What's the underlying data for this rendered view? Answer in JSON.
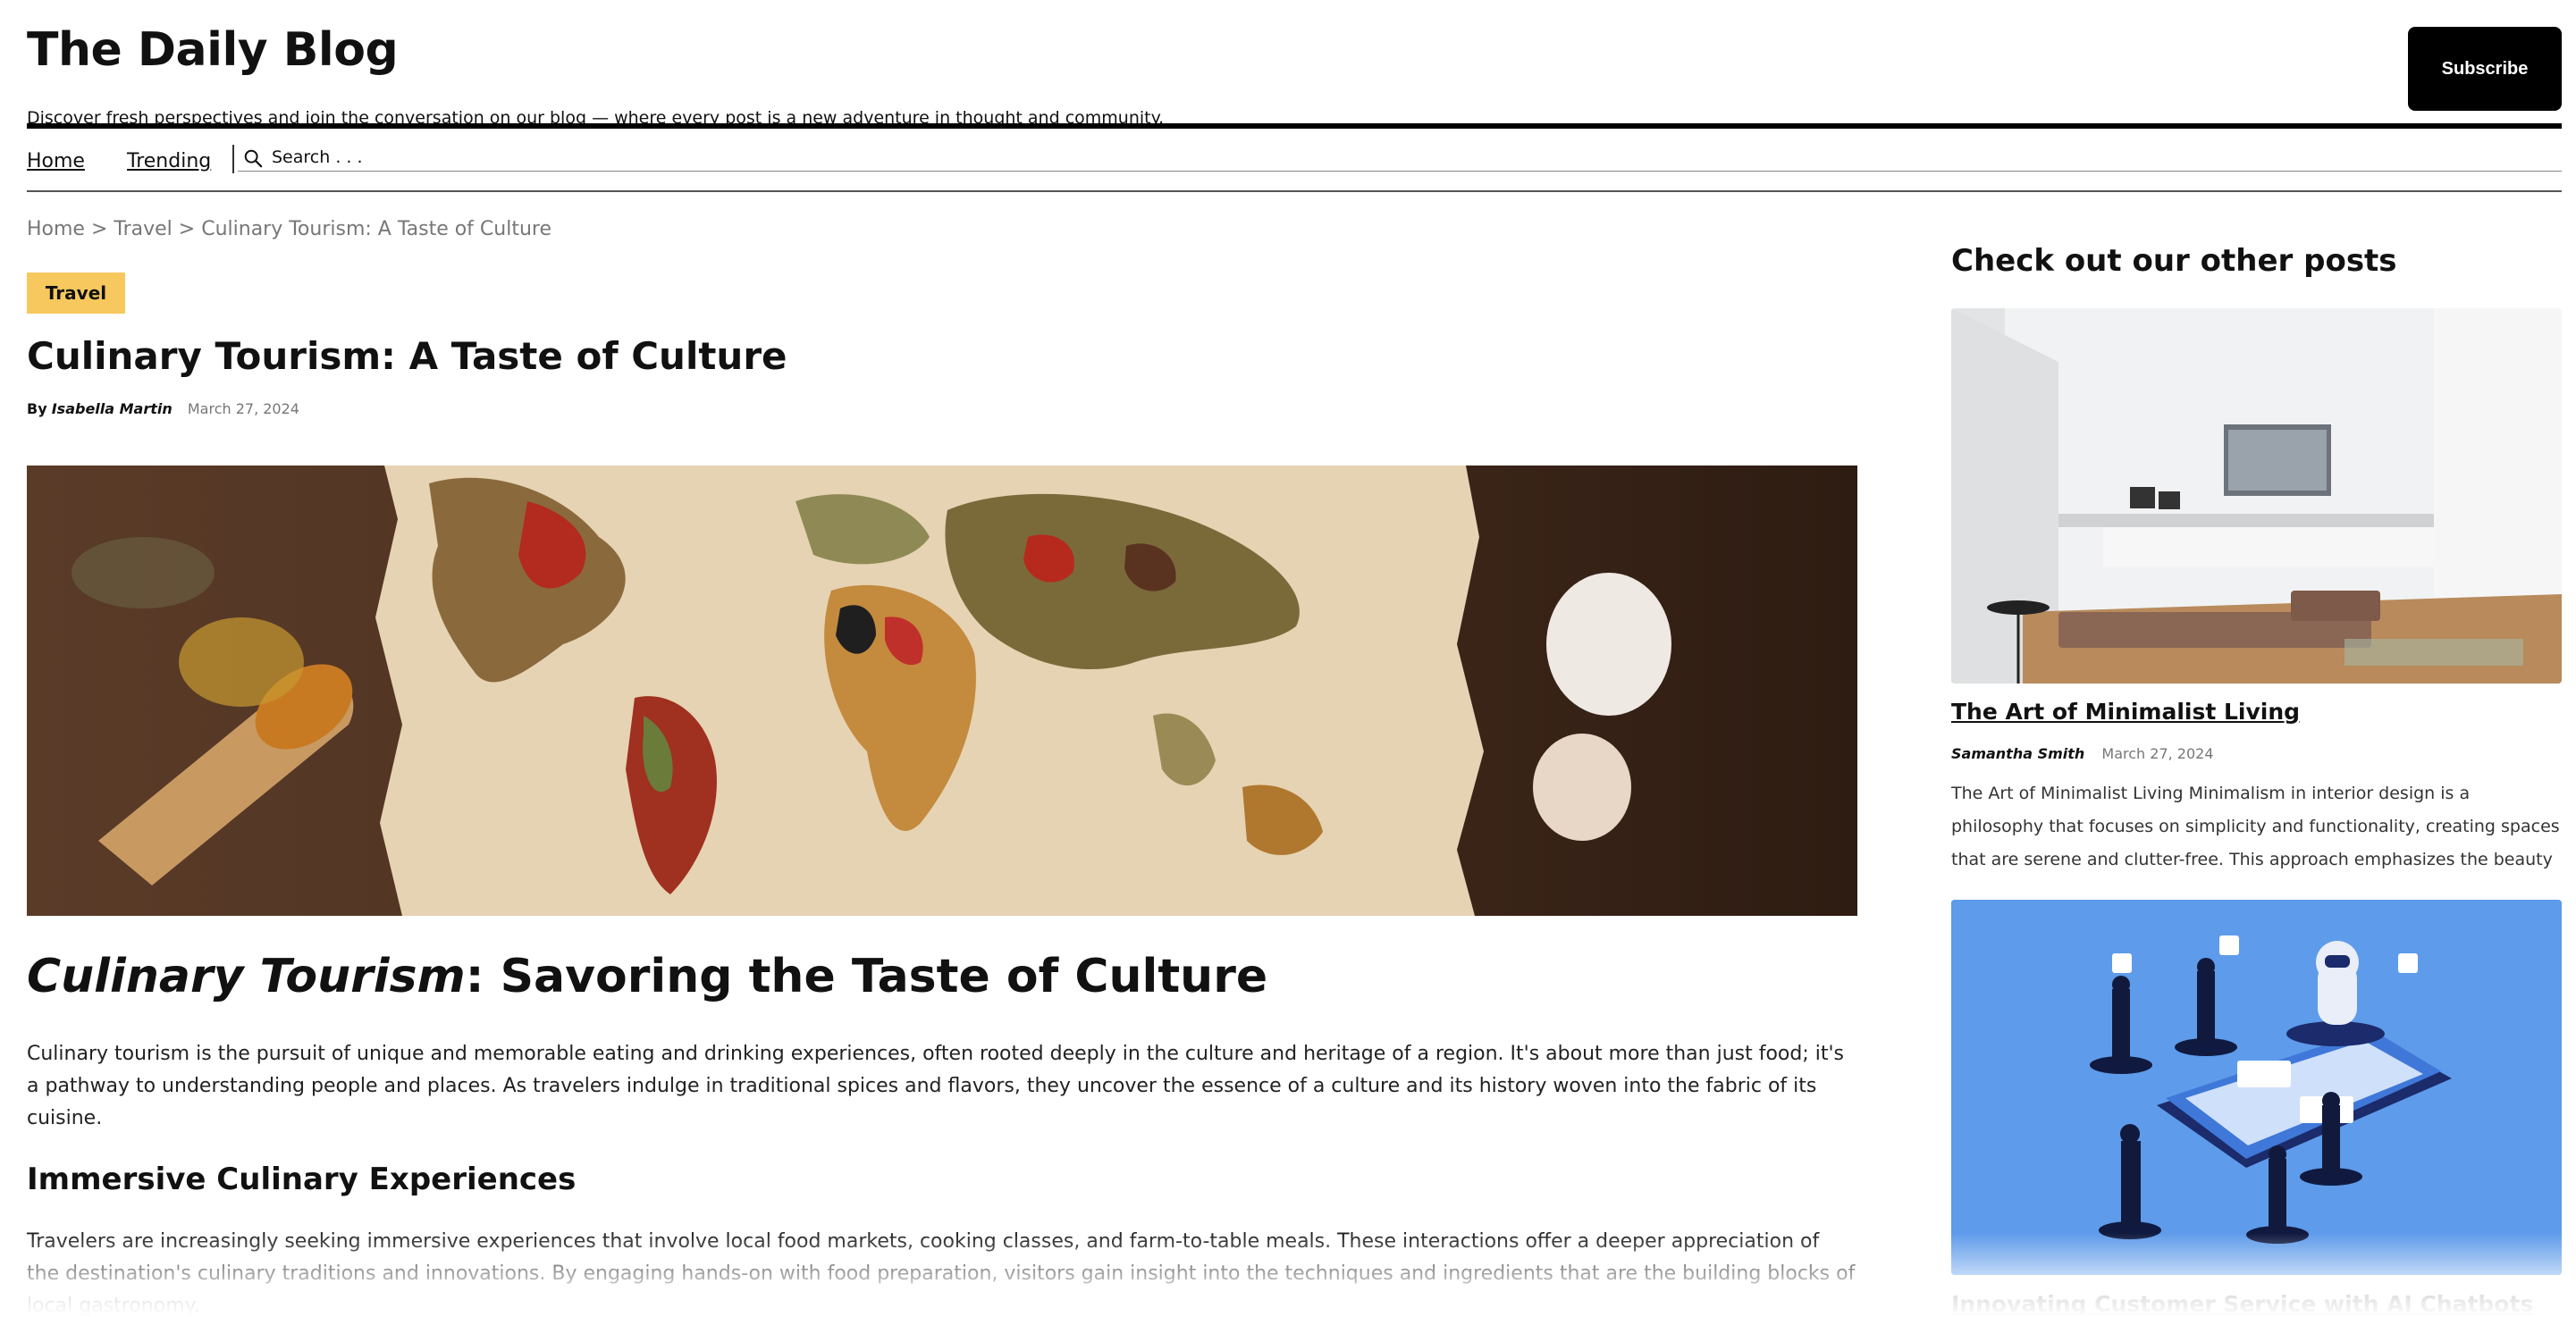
{
  "header": {
    "site_title": "The Daily Blog",
    "tagline": "Discover fresh perspectives and join the conversation on our blog — where every post is a new adventure in thought and community.",
    "subscribe_label": "Subscribe"
  },
  "nav": {
    "home": "Home",
    "trending": "Trending",
    "search_placeholder": "Search . . ."
  },
  "breadcrumb": {
    "home": "Home",
    "sep1": " > ",
    "category": "Travel",
    "sep2": " > ",
    "current": "Culinary Tourism: A Taste of Culture"
  },
  "post": {
    "tag": "Travel",
    "title": "Culinary Tourism: A Taste of Culture",
    "by": "By",
    "author": "Isabella Martin",
    "date": "March 27, 2024",
    "h1_em": "Culinary Tourism",
    "h1_rest": ": Savoring the Taste of Culture",
    "para1": "Culinary tourism is the pursuit of unique and memorable eating and drinking experiences, often rooted deeply in the culture and heritage of a region. It's about more than just food; it's a pathway to understanding people and places. As travelers indulge in traditional spices and flavors, they uncover the essence of a culture and its history woven into the fabric of its cuisine.",
    "h2": "Immersive Culinary Experiences",
    "para2": "Travelers are increasingly seeking immersive experiences that involve local food markets, cooking classes, and farm-to-table meals. These interactions offer a deeper appreciation of the destination's culinary traditions and innovations. By engaging hands-on with food preparation, visitors gain insight into the techniques and ingredients that are the building blocks of local gastronomy."
  },
  "sidebar": {
    "heading": "Check out our other posts",
    "cards": [
      {
        "title": "The Art of Minimalist Living",
        "author": "Samantha Smith",
        "date": "March 27, 2024",
        "excerpt": "The Art of Minimalist Living Minimalism in interior design is a philosophy that focuses on simplicity and functionality, creating spaces that are serene and clutter-free. This approach emphasizes the beauty of purposeful furniture and…"
      },
      {
        "title": "Innovating Customer Service with AI Chatbots"
      }
    ]
  },
  "colors": {
    "tag_bg": "#f7c85d",
    "subscribe_bg": "#000000",
    "card2_bg": "#5e9bea"
  }
}
